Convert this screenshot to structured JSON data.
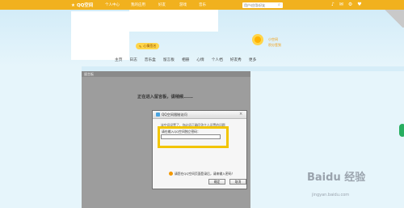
{
  "topbar": {
    "logo": "QQ空间",
    "items": [
      "个人中心",
      "我的应用",
      "好友",
      "游戏",
      "音乐"
    ],
    "search_placeholder": "用户/应用/好友"
  },
  "profile": {
    "mood_button": "心情签名",
    "side_links": [
      "小空间",
      "积分签到"
    ]
  },
  "nav": [
    "主页",
    "日志",
    "音乐盒",
    "留言板",
    "相册",
    "心情",
    "个人档",
    "好友秀",
    "更多"
  ],
  "panel": {
    "title": "留言板",
    "loading": "正在进入留言板，请稍候......"
  },
  "dialog": {
    "title": "QQ空间限制访问",
    "description": "该空间设置了，你必须正确回答主人设置的问题",
    "field_label": "请在输入QQ空间独立密码：",
    "answer_value": "",
    "warning_text": "请您在QQ空间页面登录后，请来输入密码！",
    "ok_label": "确定",
    "cancel_label": "取消"
  },
  "watermark": {
    "brand": "Baidu 经验",
    "url": "jingyan.baidu.com"
  },
  "colors": {
    "topbar": "#f1b11e",
    "highlight": "#f2c500",
    "panel_gray": "#9d9d9d"
  }
}
